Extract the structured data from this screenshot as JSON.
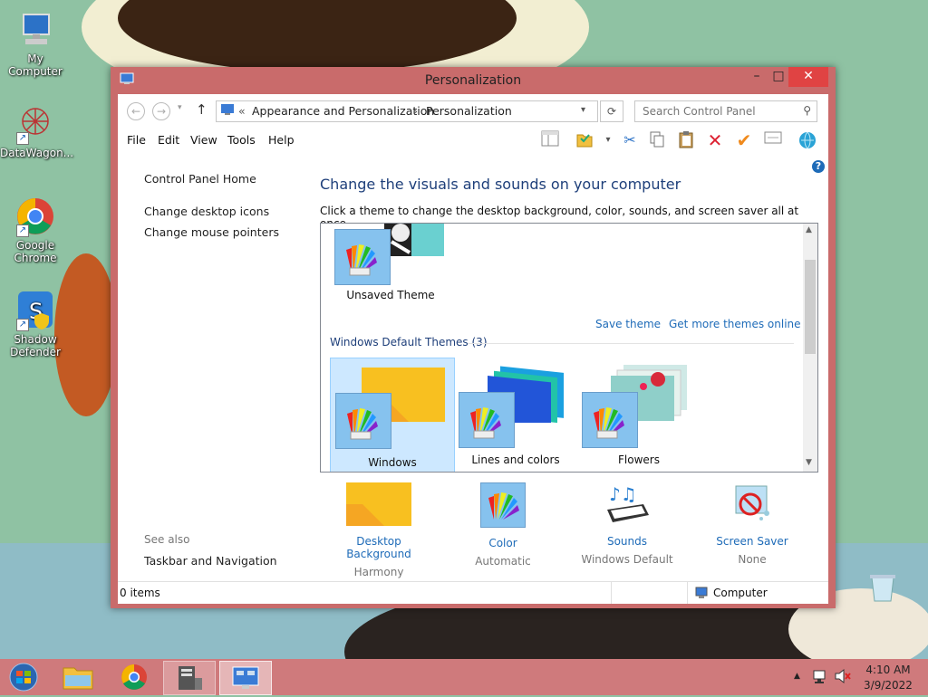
{
  "desktop": {
    "icons": [
      {
        "label": "My Computer",
        "icon": "computer-icon"
      },
      {
        "label": "DataWagon...",
        "icon": "starburst-icon"
      },
      {
        "label": "Google Chrome",
        "icon": "chrome-icon"
      },
      {
        "label": "Shadow Defender",
        "icon": "shield-icon"
      }
    ]
  },
  "window": {
    "title": "Personalization",
    "address": {
      "prefix": "«",
      "crumbs": [
        "Appearance and Personalization",
        "Personalization"
      ]
    },
    "search_placeholder": "Search Control Panel",
    "menu": [
      "File",
      "Edit",
      "View",
      "Tools",
      "Help"
    ],
    "left_links": [
      "Control Panel Home",
      "Change desktop icons",
      "Change mouse pointers"
    ],
    "see_also_label": "See also",
    "see_also_links": [
      "Taskbar and Navigation"
    ],
    "heading": "Change the visuals and sounds on your computer",
    "subheading": "Click a theme to change the desktop background, color, sounds, and screen saver all at once.",
    "unsaved_theme": "Unsaved Theme",
    "save_theme": "Save theme",
    "get_more": "Get more themes online",
    "group_title": "Windows Default Themes (3)",
    "themes": [
      "Windows",
      "Lines and colors",
      "Flowers"
    ],
    "bottom_items": [
      {
        "title": "Desktop Background",
        "value": "Harmony"
      },
      {
        "title": "Color",
        "value": "Automatic"
      },
      {
        "title": "Sounds",
        "value": "Windows Default"
      },
      {
        "title": "Screen Saver",
        "value": "None"
      }
    ],
    "status_left": "0 items",
    "status_right": "Computer"
  },
  "taskbar": {
    "time": "4:10 AM",
    "date": "3/9/2022"
  },
  "colors": {
    "link": "#1e6bb8",
    "heading": "#1e3f7a",
    "window_frame": "#c96b6b",
    "selected_tile": "#cde8ff"
  }
}
